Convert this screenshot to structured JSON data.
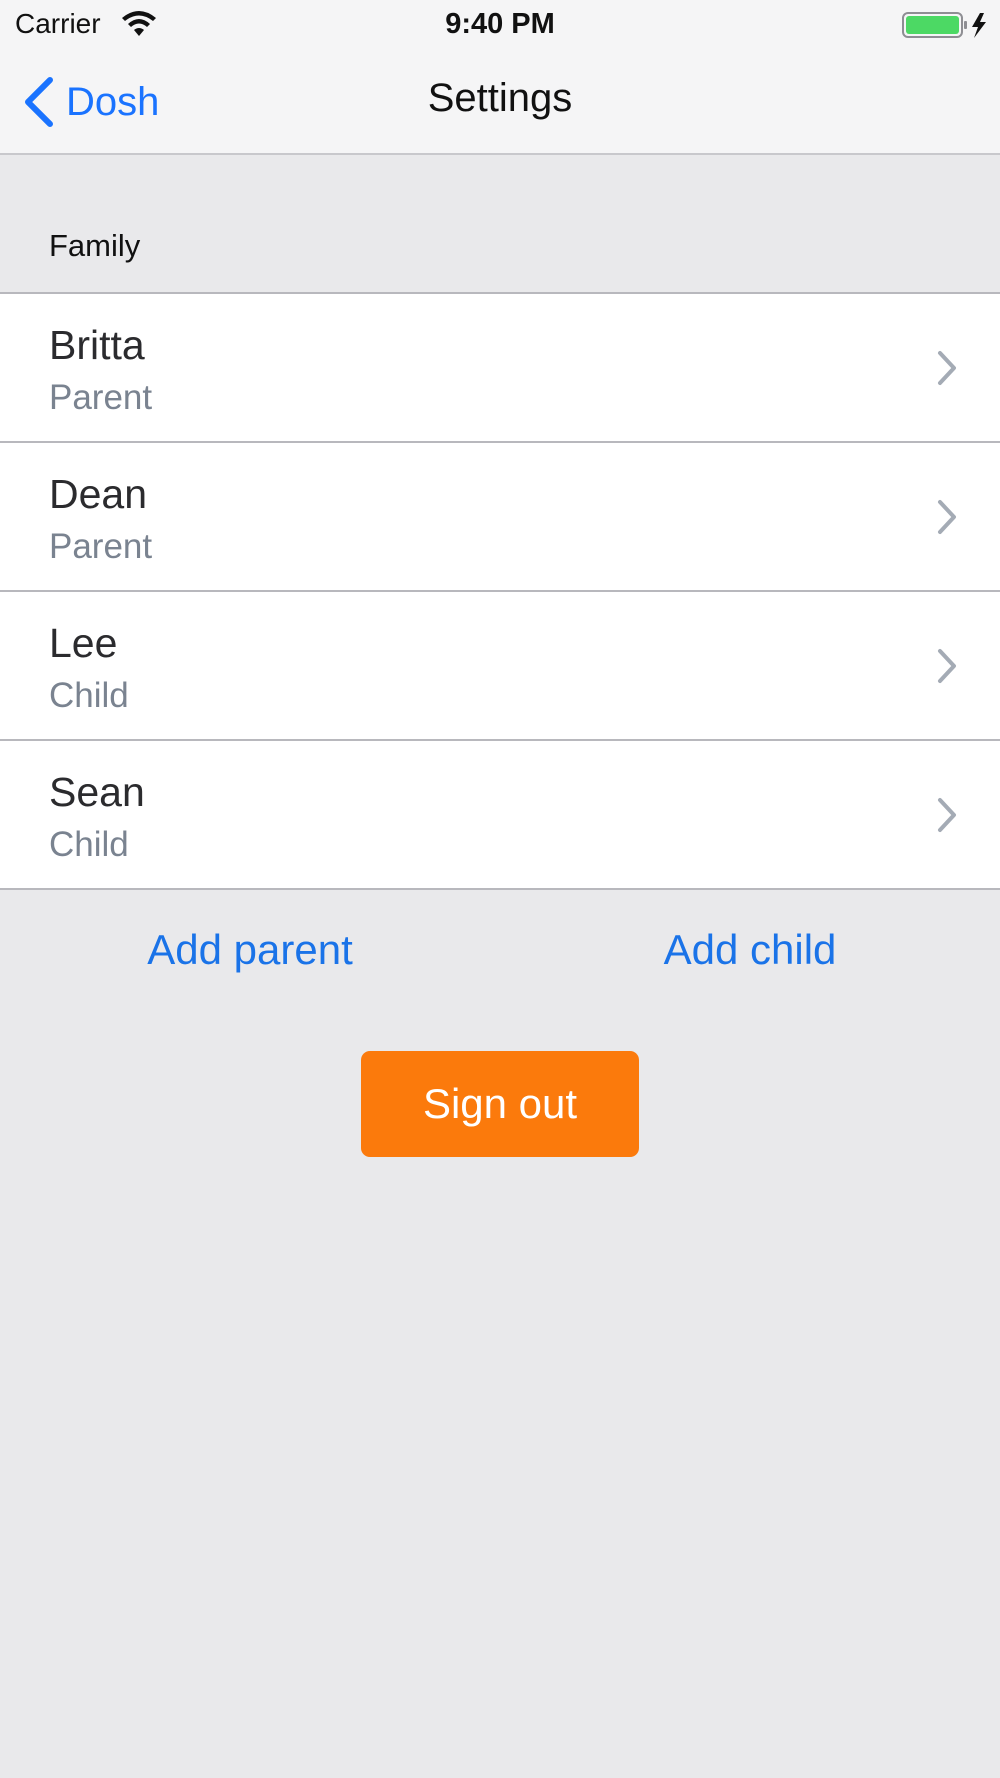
{
  "status_bar": {
    "carrier": "Carrier",
    "time": "9:40 PM",
    "wifi_icon": "wifi-icon",
    "battery_icon": "battery-charging-icon",
    "battery_color": "#4cd964"
  },
  "nav": {
    "back_label": "Dosh",
    "back_icon": "chevron-left-icon",
    "title": "Settings"
  },
  "family": {
    "header": "Family",
    "members": [
      {
        "name": "Britta",
        "role": "Parent"
      },
      {
        "name": "Dean",
        "role": "Parent"
      },
      {
        "name": "Lee",
        "role": "Child"
      },
      {
        "name": "Sean",
        "role": "Child"
      }
    ],
    "row_icon": "chevron-right-icon"
  },
  "actions": {
    "add_parent": "Add parent",
    "add_child": "Add child",
    "sign_out": "Sign out"
  },
  "colors": {
    "accent": "#1a73e8",
    "sign_out_bg": "#fb7a0c",
    "background": "#e9e9eb",
    "secondary_text": "#7a8390"
  }
}
